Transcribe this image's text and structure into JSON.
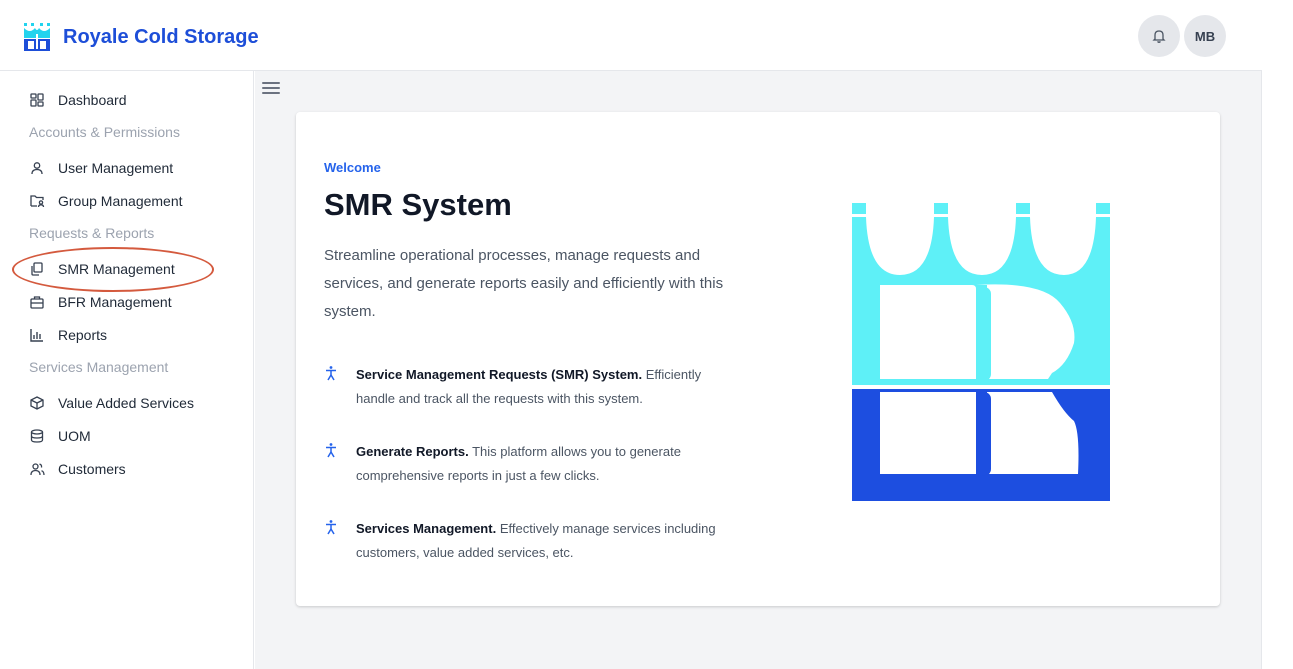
{
  "header": {
    "brand_name": "Royale Cold Storage",
    "avatar_initials": "MB"
  },
  "sidebar": {
    "dashboard": "Dashboard",
    "section_accounts": "Accounts & Permissions",
    "user_management": "User Management",
    "group_management": "Group Management",
    "section_requests": "Requests & Reports",
    "smr_management": "SMR Management",
    "bfr_management": "BFR Management",
    "reports": "Reports",
    "section_services": "Services Management",
    "value_added_services": "Value Added Services",
    "uom": "UOM",
    "customers": "Customers"
  },
  "main": {
    "welcome": "Welcome",
    "title": "SMR System",
    "description": "Streamline operational processes, manage requests and services, and generate reports easily and efficiently with this system.",
    "features": [
      {
        "title": "Service Management Requests (SMR) System.",
        "text": "Efficiently handle and track all the requests with this system."
      },
      {
        "title": "Generate Reports.",
        "text": "This platform allows you to generate comprehensive reports in just a few clicks."
      },
      {
        "title": "Services Management.",
        "text": "Effectively manage services including customers, value added services, etc."
      }
    ]
  },
  "colors": {
    "brand_blue": "#1d4ed8",
    "logo_cyan": "#5ef0f7",
    "logo_blue": "#1d4ee0",
    "highlight_ring": "#d45a3e"
  },
  "icons": {
    "brand": "castle-logo-icon",
    "bell": "bell-icon",
    "menu": "hamburger-menu-icon",
    "dashboard": "grid-icon",
    "user": "user-icon",
    "group": "folder-user-icon",
    "smr": "copy-document-icon",
    "bfr": "briefcase-icon",
    "reports": "bar-chart-icon",
    "vas": "package-icon",
    "uom": "database-icon",
    "customers": "users-icon",
    "feature": "accessibility-icon"
  }
}
